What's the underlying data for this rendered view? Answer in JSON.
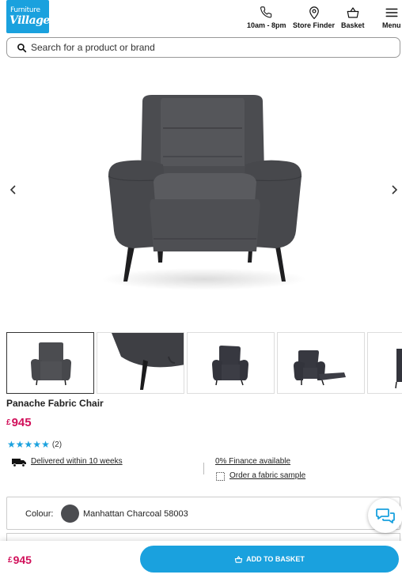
{
  "brand": {
    "logo_line1": "Furniture",
    "logo_line2": "Village"
  },
  "header": {
    "hours_label": "10am - 8pm",
    "store_finder_label": "Store Finder",
    "basket_label": "Basket",
    "menu_label": "Menu"
  },
  "search": {
    "placeholder": "Search for a product or brand"
  },
  "product": {
    "title": "Panache Fabric Chair",
    "currency": "£",
    "price": "945",
    "rating": 5,
    "review_count": "(2)",
    "delivery": "Delivered within 10 weeks",
    "finance": "0% Finance available",
    "sample": "Order a fabric sample"
  },
  "gallery": {
    "thumbnails": [
      "front view",
      "leg detail",
      "angled view",
      "reclined view",
      "side view"
    ],
    "active_index": 0
  },
  "options": {
    "colour_label": "Colour:",
    "colour_value": "Manhattan Charcoal 58003",
    "swatch_color": "#4b4c50"
  },
  "bottom_bar": {
    "currency": "£",
    "price": "945",
    "cta_label": "ADD TO BASKET"
  },
  "colors": {
    "brand_blue": "#1aa1de",
    "price_pink": "#d1105a",
    "chair_fabric": "#4b4c50"
  }
}
